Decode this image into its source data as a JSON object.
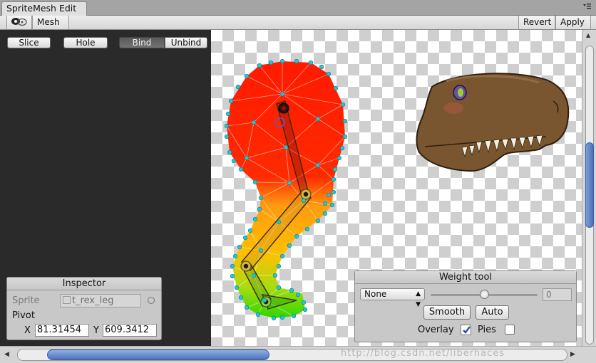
{
  "window": {
    "tab_title": "SpriteMesh Edit"
  },
  "toolbar": {
    "view_icon": "eye-toggle-icon",
    "mesh_label": "Mesh",
    "revert_label": "Revert",
    "apply_label": "Apply"
  },
  "tools": {
    "slice_label": "Slice",
    "hole_label": "Hole",
    "bind_label": "Bind",
    "unbind_label": "Unbind",
    "active_tool": "Bind"
  },
  "inspector": {
    "title": "Inspector",
    "sprite_label": "Sprite",
    "sprite_value": "t_rex_leg",
    "pivot_label": "Pivot",
    "x_label": "X",
    "x_value": "81.31454",
    "y_label": "Y",
    "y_value": "609.3412"
  },
  "weight_tool": {
    "title": "Weight tool",
    "mode_value": "None",
    "slider_value": "0",
    "smooth_label": "Smooth",
    "auto_label": "Auto",
    "overlay_label": "Overlay",
    "overlay_checked": true,
    "pies_label": "Pies",
    "pies_checked": false
  },
  "watermark": "http://blog.csdn.net/liberhaces",
  "colors": {
    "weight_red": "#ff1a00",
    "weight_orange": "#ffaa00",
    "weight_green": "#2ed600",
    "vertex": "#22c7d6",
    "bone": "#c9a12a"
  }
}
